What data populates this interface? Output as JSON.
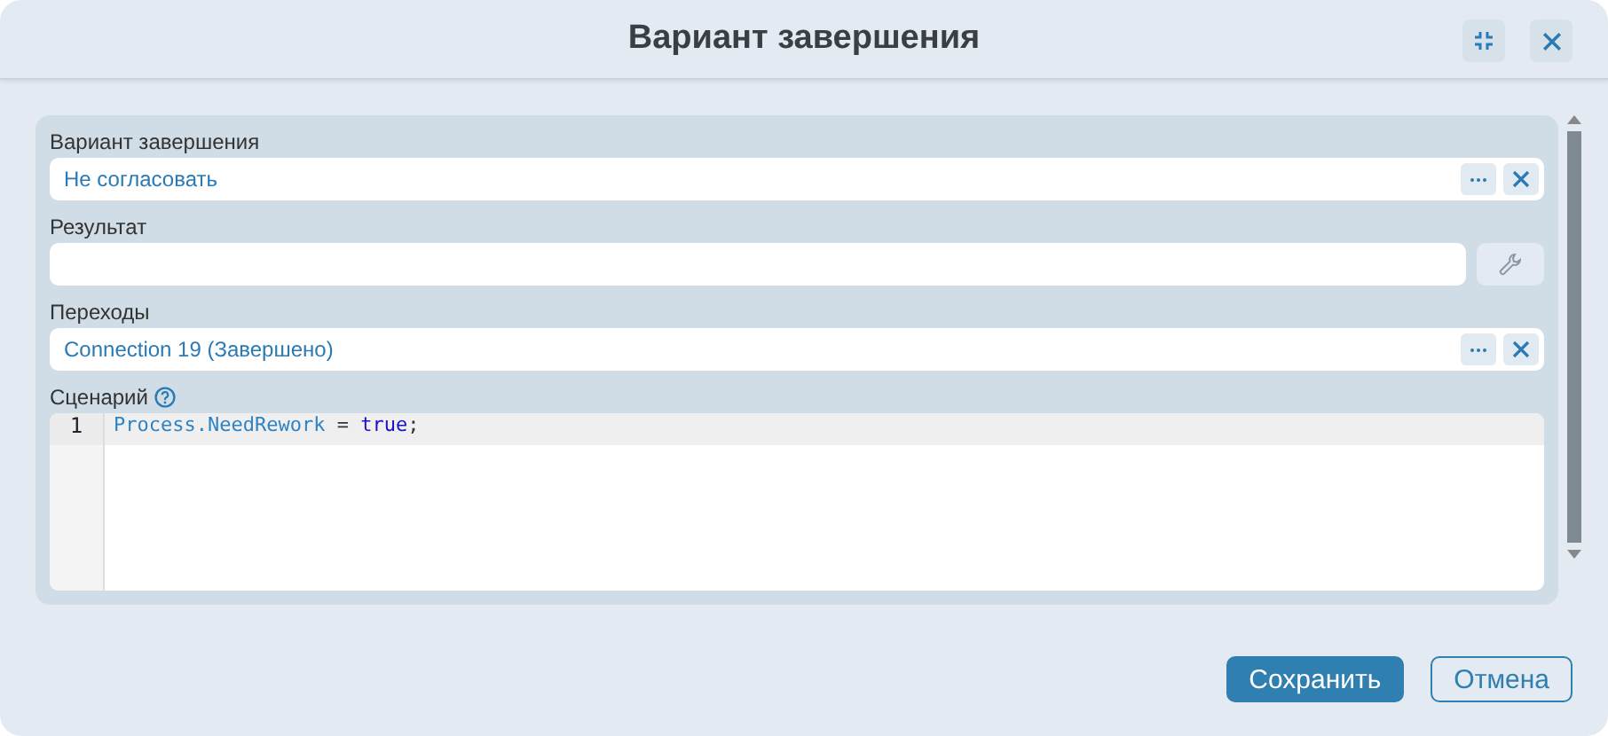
{
  "dialog": {
    "title": "Вариант завершения"
  },
  "fields": [
    {
      "kind": "lookup",
      "label": "Вариант завершения",
      "value": "Не согласовать"
    },
    {
      "kind": "action",
      "label": "Результат"
    },
    {
      "kind": "lookup",
      "label": "Переходы",
      "value": "Connection 19 (Завершено)"
    },
    {
      "kind": "code",
      "label": "Сценарий",
      "help": true,
      "lines": [
        {
          "number": "1",
          "tokens": [
            {
              "kind": "ident",
              "text": "Process.NeedRework"
            },
            {
              "kind": "plain",
              "text": " = "
            },
            {
              "kind": "keyword",
              "text": "true"
            },
            {
              "kind": "plain",
              "text": ";"
            }
          ]
        }
      ]
    }
  ],
  "buttons": [
    {
      "kind": "primary",
      "label": "Сохранить"
    },
    {
      "kind": "secondary",
      "label": "Отмена"
    }
  ]
}
